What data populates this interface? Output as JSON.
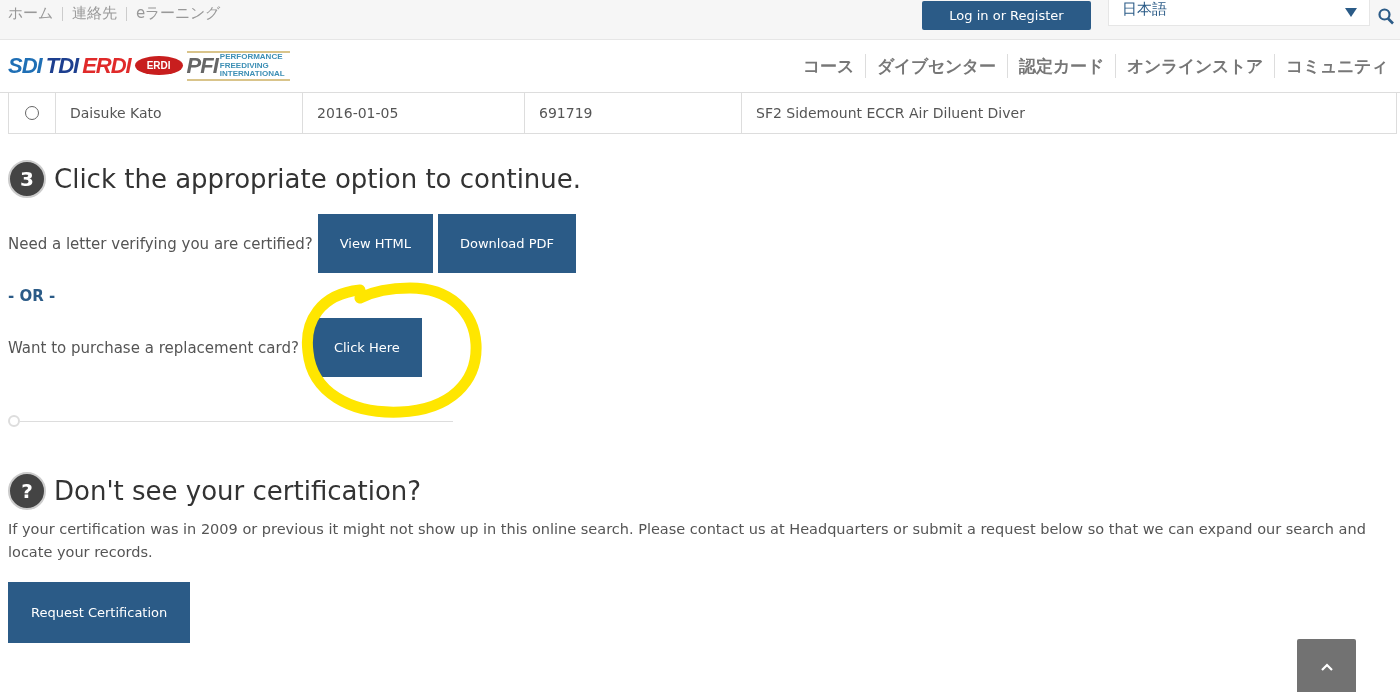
{
  "top_links": [
    "ホーム",
    "連絡先",
    "eラーニング"
  ],
  "login_button": "Log in or Register",
  "language_select": {
    "value": "日本語"
  },
  "logos": [
    {
      "text": "SDI",
      "color": "#1f6fb5"
    },
    {
      "text": "TDI",
      "color": "#1d3f8f"
    },
    {
      "text": "ERDI",
      "color": "#e02a2a"
    },
    {
      "text": "ERDI",
      "color": "#c81e1e",
      "kind": "badge"
    },
    {
      "text": "PFI",
      "color": "#666666",
      "sub": "PERFORMANCE FREEDIVING INTERNATIONAL"
    }
  ],
  "nav": [
    "コース",
    "ダイブセンター",
    "認定カード",
    "オンラインストア",
    "コミュニティ"
  ],
  "table": {
    "rows": [
      {
        "selected": false,
        "name": "Daisuke Kato",
        "date": "2016-01-05",
        "number": "691719",
        "course": "SF2 Sidemount ECCR Air Diluent Diver"
      }
    ]
  },
  "step": {
    "badge": "3",
    "heading": "Click the appropriate option to continue.",
    "letter_prompt": "Need a letter verifying you are certified?",
    "letter_buttons": [
      "View HTML",
      "Download PDF"
    ],
    "or": "- OR -",
    "card_prompt": "Want to purchase a replacement card?",
    "card_button": "Click Here"
  },
  "help": {
    "badge": "?",
    "heading": "Don't see your certification?",
    "text": "If your certification was in 2009 or previous it might not show up in this online search. Please contact us at Headquarters or submit a request below so that we can expand our search and locate your records.",
    "button": "Request Certification"
  }
}
